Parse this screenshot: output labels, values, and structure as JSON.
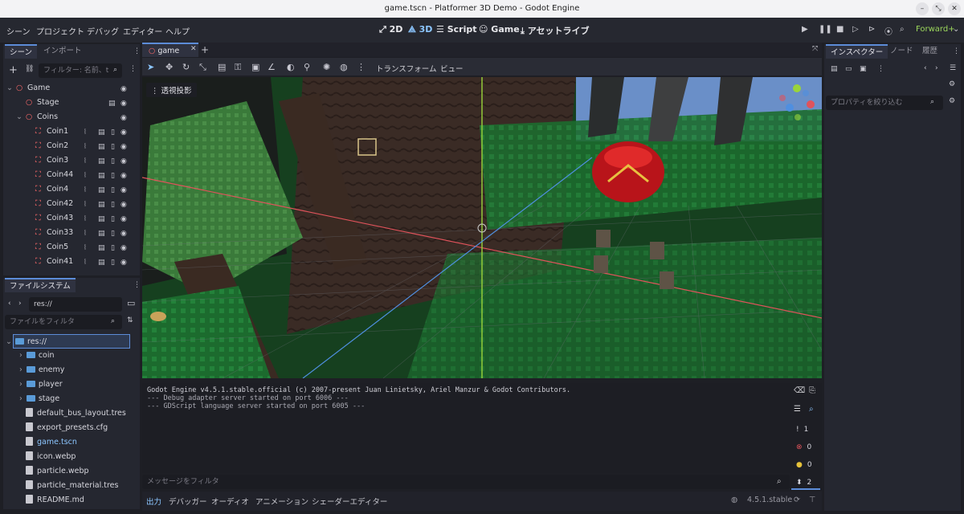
{
  "window": {
    "title": "game.tscn - Platformer 3D Demo - Godot Engine"
  },
  "menu": [
    "シーン",
    "プロジェクト",
    "デバッグ",
    "エディター",
    "ヘルプ"
  ],
  "workspaces": {
    "w2d": "2D",
    "w3d": "3D",
    "script": "Script",
    "game": "Game",
    "assetlib": "アセットライブ"
  },
  "renderer": "Forward+",
  "scene_dock": {
    "tab_scene": "シーン",
    "tab_import": "インポート",
    "filter_placeholder": "フィルター: 名前、t",
    "nodes": [
      {
        "label": "Game",
        "level": 0,
        "arrow": "⌄"
      },
      {
        "label": "Stage",
        "level": 1,
        "arrow": ""
      },
      {
        "label": "Coins",
        "level": 1,
        "arrow": "⌄"
      },
      {
        "label": "Coin1",
        "level": 2,
        "arrow": ""
      },
      {
        "label": "Coin2",
        "level": 2,
        "arrow": ""
      },
      {
        "label": "Coin3",
        "level": 2,
        "arrow": ""
      },
      {
        "label": "Coin44",
        "level": 2,
        "arrow": ""
      },
      {
        "label": "Coin4",
        "level": 2,
        "arrow": ""
      },
      {
        "label": "Coin42",
        "level": 2,
        "arrow": ""
      },
      {
        "label": "Coin43",
        "level": 2,
        "arrow": ""
      },
      {
        "label": "Coin33",
        "level": 2,
        "arrow": ""
      },
      {
        "label": "Coin5",
        "level": 2,
        "arrow": ""
      },
      {
        "label": "Coin41",
        "level": 2,
        "arrow": ""
      }
    ]
  },
  "fs_dock": {
    "tab": "ファイルシステム",
    "path": "res://",
    "filter_placeholder": "ファイルをフィルタ",
    "items": [
      {
        "label": "res://",
        "type": "root"
      },
      {
        "label": "coin",
        "type": "folder"
      },
      {
        "label": "enemy",
        "type": "folder"
      },
      {
        "label": "player",
        "type": "folder"
      },
      {
        "label": "stage",
        "type": "folder"
      },
      {
        "label": "default_bus_layout.tres",
        "type": "file"
      },
      {
        "label": "export_presets.cfg",
        "type": "file"
      },
      {
        "label": "game.tscn",
        "type": "scene"
      },
      {
        "label": "icon.webp",
        "type": "file"
      },
      {
        "label": "particle.webp",
        "type": "file"
      },
      {
        "label": "particle_material.tres",
        "type": "file"
      },
      {
        "label": "README.md",
        "type": "file"
      }
    ]
  },
  "editor": {
    "tab": "game",
    "transform_menu": "トランスフォーム",
    "view_menu": "ビュー",
    "perspective": "透視投影"
  },
  "output": {
    "lines": [
      "Godot Engine v4.5.1.stable.official (c) 2007-present Juan Linietsky, Ariel Manzur & Godot Contributors.",
      "--- Debug adapter server started on port 6006 ---",
      "--- GDScript language server started on port 6005 ---"
    ],
    "filter_placeholder": "メッセージをフィルタ",
    "counts": {
      "log": "1",
      "errors": "0",
      "warnings": "0",
      "messages": "2"
    }
  },
  "bottom_tabs": [
    "出力",
    "デバッガー",
    "オーディオ",
    "アニメーション",
    "シェーダーエディター"
  ],
  "version": "4.5.1.stable",
  "inspector": {
    "tab_inspector": "インスペクター",
    "tab_node": "ノード",
    "tab_history": "履歴",
    "filter_placeholder": "プロパティを絞り込む"
  },
  "colors": {
    "accent": "#5c8cd8",
    "node": "#ff6b6b",
    "x_axis": "#e0535b",
    "y_axis": "#9ad43a",
    "z_axis": "#4f8fe0"
  }
}
